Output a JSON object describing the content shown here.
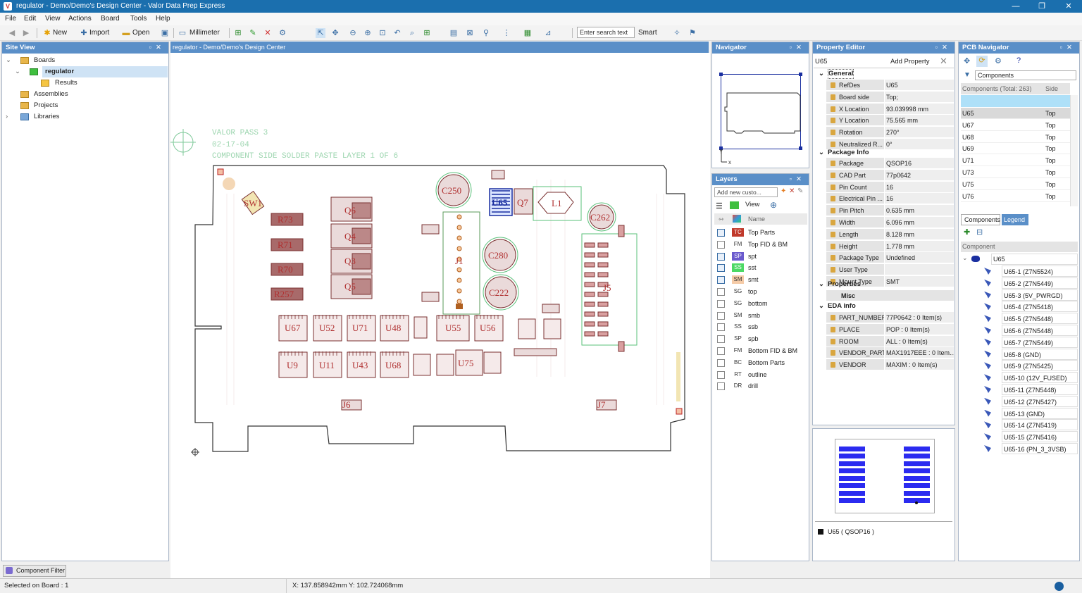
{
  "window": {
    "title": "regulator - Demo/Demo's Design Center - Valor Data Prep Express",
    "controls": [
      "—",
      "❐",
      "✕"
    ]
  },
  "menu": [
    "File",
    "Edit",
    "View",
    "Actions",
    "Board",
    "Tools",
    "Help"
  ],
  "toolbar": {
    "new": "New",
    "import": "Import",
    "open": "Open",
    "units": "Millimeter",
    "search_placeholder": "Enter search text",
    "search_mode": "Smart"
  },
  "site_view": {
    "title": "Site View",
    "items": [
      "Boards",
      "regulator",
      "Results",
      "Assemblies",
      "Projects",
      "Libraries"
    ],
    "filter_button": "Component Filter"
  },
  "canvas": {
    "tab": "regulator - Demo/Demo's Design Center",
    "silk_lines": [
      "VALOR PASS 3",
      "02-17-04",
      "COMPONENT SIDE SOLDER PASTE LAYER 1 OF 6"
    ],
    "refdes": [
      "SW1",
      "R73",
      "R71",
      "R70",
      "R257",
      "Q6",
      "Q4",
      "Q3",
      "Q5",
      "C250",
      "U65",
      "Q7",
      "L1",
      "C262",
      "C280",
      "C222",
      "J1",
      "J5",
      "U67",
      "U52",
      "U71",
      "U48",
      "U55",
      "U56",
      "U9",
      "U11",
      "U43",
      "U68",
      "U75",
      "J6",
      "J7"
    ]
  },
  "navigator": {
    "title": "Navigator",
    "axis_x": "x",
    "axis_y": "Y"
  },
  "layers": {
    "title": "Layers",
    "add_placeholder": "Add new custo...",
    "view_label": "View",
    "col_name": "Name",
    "rows": [
      {
        "code": "TC",
        "name": "Top Parts",
        "color": "#c0392b",
        "fg": "#fff",
        "checked": true
      },
      {
        "code": "FM",
        "name": "Top FID & BM",
        "color": "",
        "fg": "#333",
        "checked": false
      },
      {
        "code": "SP",
        "name": "spt",
        "color": "#6a5acd",
        "fg": "#fff",
        "checked": true
      },
      {
        "code": "SS",
        "name": "sst",
        "color": "#4cd964",
        "fg": "#fff",
        "checked": true
      },
      {
        "code": "SM",
        "name": "smt",
        "color": "#f5cba7",
        "fg": "#333",
        "checked": true
      },
      {
        "code": "SG",
        "name": "top",
        "color": "",
        "fg": "#333",
        "checked": false
      },
      {
        "code": "SG",
        "name": "bottom",
        "color": "",
        "fg": "#333",
        "checked": false
      },
      {
        "code": "SM",
        "name": "smb",
        "color": "",
        "fg": "#333",
        "checked": false
      },
      {
        "code": "SS",
        "name": "ssb",
        "color": "",
        "fg": "#333",
        "checked": false
      },
      {
        "code": "SP",
        "name": "spb",
        "color": "",
        "fg": "#333",
        "checked": false
      },
      {
        "code": "FM",
        "name": "Bottom FID & BM",
        "color": "",
        "fg": "#333",
        "checked": false
      },
      {
        "code": "BC",
        "name": "Bottom Parts",
        "color": "",
        "fg": "#333",
        "checked": false
      },
      {
        "code": "RT",
        "name": "outline",
        "color": "",
        "fg": "#333",
        "checked": false
      },
      {
        "code": "DR",
        "name": "drill",
        "color": "",
        "fg": "#333",
        "checked": false
      }
    ]
  },
  "property_editor": {
    "title": "Property Editor",
    "object": "U65",
    "add_property": "Add Property",
    "general_label": "General",
    "general": [
      [
        "RefDes",
        "U65"
      ],
      [
        "Board side",
        "Top;"
      ],
      [
        "X Location",
        "93.039998 mm"
      ],
      [
        "Y Location",
        "75.565 mm"
      ],
      [
        "Rotation",
        "270°"
      ],
      [
        "Neutralized R...",
        "0°"
      ]
    ],
    "package_label": "Package Info",
    "package": [
      [
        "Package",
        "QSOP16"
      ],
      [
        "CAD Part",
        "77p0642"
      ],
      [
        "Pin Count",
        "16"
      ],
      [
        "Electrical Pin ...",
        "16"
      ],
      [
        "Pin Pitch",
        "0.635 mm"
      ],
      [
        "Width",
        "6.096 mm"
      ],
      [
        "Length",
        "8.128 mm"
      ],
      [
        "Height",
        "1.778 mm"
      ],
      [
        "Package Type",
        "Undefined"
      ],
      [
        "User Type",
        ""
      ],
      [
        "Mount Type",
        "SMT"
      ]
    ],
    "properties_label": "Properties",
    "misc_label": "Misc",
    "eda_label": "EDA info",
    "eda": [
      [
        "PART_NUMBER",
        "77P0642 : 0 Item(s)"
      ],
      [
        "PLACE",
        "POP : 0 Item(s)"
      ],
      [
        "ROOM",
        "ALL : 0 Item(s)"
      ],
      [
        "VENDOR_PART",
        "MAX1917EEE : 0 Item..."
      ],
      [
        "VENDOR",
        "MAXIM : 0 Item(s)"
      ]
    ],
    "preview_caption": "U65 ( QSOP16 )"
  },
  "pcb_navigator": {
    "title": "PCB Navigator",
    "filter": "Components",
    "col_components": "Components (Total: 263)",
    "col_side": "Side",
    "rows": [
      [
        "U65",
        "Top"
      ],
      [
        "U67",
        "Top"
      ],
      [
        "U68",
        "Top"
      ],
      [
        "U69",
        "Top"
      ],
      [
        "U71",
        "Top"
      ],
      [
        "U73",
        "Top"
      ],
      [
        "U75",
        "Top"
      ],
      [
        "U76",
        "Top"
      ]
    ],
    "tabs": [
      "Components",
      "Legend"
    ],
    "col_component": "Component",
    "root": "U65",
    "pins": [
      "U65-1  (Z7N5524)",
      "U65-2  (Z7N5449)",
      "U65-3  (5V_PWRGD)",
      "U65-4  (Z7N5418)",
      "U65-5  (Z7N5448)",
      "U65-6  (Z7N5448)",
      "U65-7  (Z7N5449)",
      "U65-8  (GND)",
      "U65-9  (Z7N5425)",
      "U65-10  (12V_FUSED)",
      "U65-11  (Z7N5448)",
      "U65-12  (Z7N5427)",
      "U65-13  (GND)",
      "U65-14  (Z7N5419)",
      "U65-15  (Z7N5416)",
      "U65-16  (PN_3_3VSB)"
    ]
  },
  "status": {
    "selected": "Selected on Board : 1",
    "coords": "X: 137.858942mm Y: 102.724068mm"
  }
}
